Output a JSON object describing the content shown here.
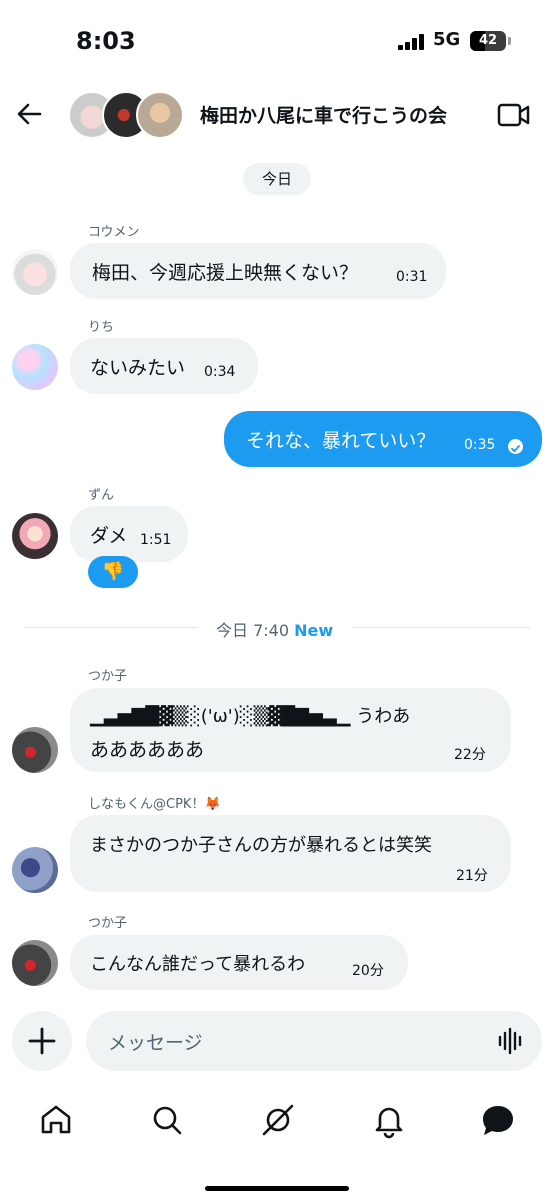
{
  "status_bar": {
    "time": "8:03",
    "network": "5G",
    "battery": "42",
    "battery_level": 0.42
  },
  "header": {
    "group_name": "梅田か八尾に車で行こうの会"
  },
  "date_today": "今日",
  "divider": {
    "label": "今日 7:40",
    "new_label": "New"
  },
  "messages": [
    {
      "sender": "コウメン",
      "text": "梅田、今週応援上映無くない？",
      "time": "0:31"
    },
    {
      "sender": "りち",
      "text": "ないみたい",
      "time": "0:34"
    },
    {
      "sender": "",
      "text": "それな、暴れていい？",
      "time": "0:35"
    },
    {
      "sender": "ずん",
      "text": "ダメ",
      "time": "1:51",
      "reaction": "👎"
    },
    {
      "sender": "つか子",
      "line1": "▁▃▅▇█▓▒░('ω')░▒▓█▇▅▃▁ うわあ",
      "line2": "ああああああ",
      "time": "22分"
    },
    {
      "sender": "しなもくん@CPK！🦊",
      "text": "まさかのつか子さんの方が暴れるとは笑笑",
      "time": "21分"
    },
    {
      "sender": "つか子",
      "text": "こんなん誰だって暴れるわ",
      "time": "20分"
    }
  ],
  "composer": {
    "placeholder": "メッセージ"
  },
  "colors": {
    "accent": "#1d9bf0",
    "bubble": "#eff3f4",
    "secondary_text": "#536471"
  },
  "icons": [
    "back-arrow-icon",
    "video-camera-icon",
    "plus-icon",
    "voice-wave-icon",
    "home-icon",
    "search-icon",
    "grok-icon",
    "bell-icon",
    "messages-icon"
  ]
}
